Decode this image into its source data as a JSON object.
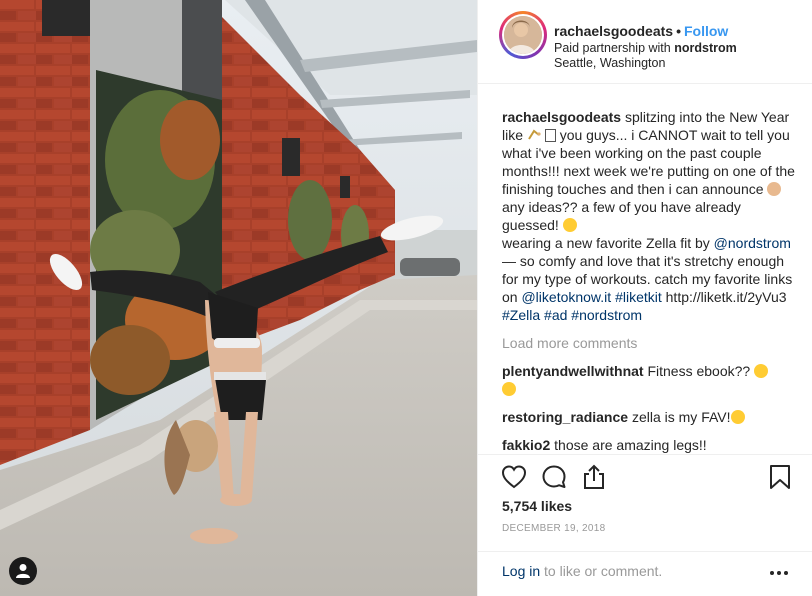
{
  "post": {
    "username": "rachaelsgoodeats",
    "follow_label": "Follow",
    "partnership_prefix": "Paid partnership with",
    "partner": "nordstrom",
    "location": "Seattle, Washington"
  },
  "caption": {
    "username": "rachaelsgoodeats",
    "part1": "splitzing into the New Year like",
    "part2": "you guys... i CANNOT wait to tell you what i've been working on the past couple months!!! next week we're putting on one of the finishing touches and then i can announce",
    "part3": "any ideas?? a few of you have already guessed!",
    "part4": "wearing a new favorite Zella fit by",
    "mention_nordstrom": "@nordstrom",
    "part5": "— so comfy and love that it's stretchy enough for my type of workouts. catch my favorite links on",
    "mention_liketoknow": "@liketoknow.it",
    "tag_liketkit": "#liketkit",
    "url": "http://liketk.it/2yVu3",
    "tag_zella": "#Zella",
    "tag_ad": "#ad",
    "tag_nordstrom": "#nordstrom"
  },
  "load_more": "Load more comments",
  "comments": [
    {
      "user": "plentyandwellwithnat",
      "text": "Fitness ebook??"
    },
    {
      "user": "restoring_radiance",
      "text": "zella is my FAV!"
    },
    {
      "user": "fakkio2",
      "text": "those are amazing legs!!"
    }
  ],
  "likes": "5,754 likes",
  "date": "DECEMBER 19, 2018",
  "footer": {
    "login_link": "Log in",
    "login_rest": "to like or comment."
  },
  "icons": {
    "like": "heart-icon",
    "comment": "speech-bubble-icon",
    "share": "share-icon",
    "save": "bookmark-icon",
    "more": "more-options-icon",
    "user_tag": "user-tag-icon"
  },
  "colors": {
    "follow": "#3897f0",
    "link": "#003569",
    "muted": "#999999",
    "text": "#262626"
  }
}
